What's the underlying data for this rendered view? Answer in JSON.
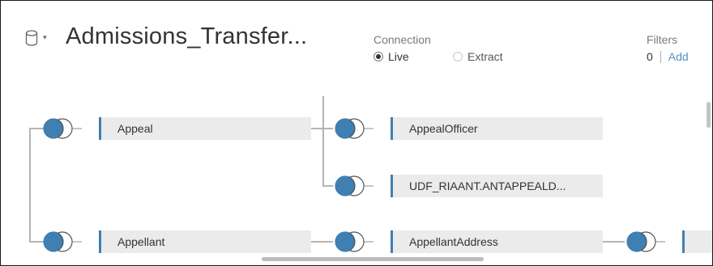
{
  "header": {
    "datasource_title": "Admissions_Transfer...",
    "connection": {
      "label": "Connection",
      "options": [
        {
          "label": "Live",
          "selected": true
        },
        {
          "label": "Extract",
          "selected": false
        }
      ]
    },
    "filters": {
      "label": "Filters",
      "count": "0",
      "add_label": "Add"
    }
  },
  "canvas": {
    "tables": [
      {
        "name": "Appeal"
      },
      {
        "name": "AppealOfficer"
      },
      {
        "name": "UDF_RIAANT.ANTAPPEALD..."
      },
      {
        "name": "Appellant"
      },
      {
        "name": "AppellantAddress"
      },
      {
        "name": ""
      }
    ],
    "joins": [
      "inner",
      "inner",
      "inner",
      "inner",
      "inner",
      "inner"
    ]
  },
  "colors": {
    "join_fill": "#3f7fb2",
    "accent_link": "#5a90c0",
    "pill_bg": "#ebebeb",
    "wire": "#b4b4b4"
  }
}
